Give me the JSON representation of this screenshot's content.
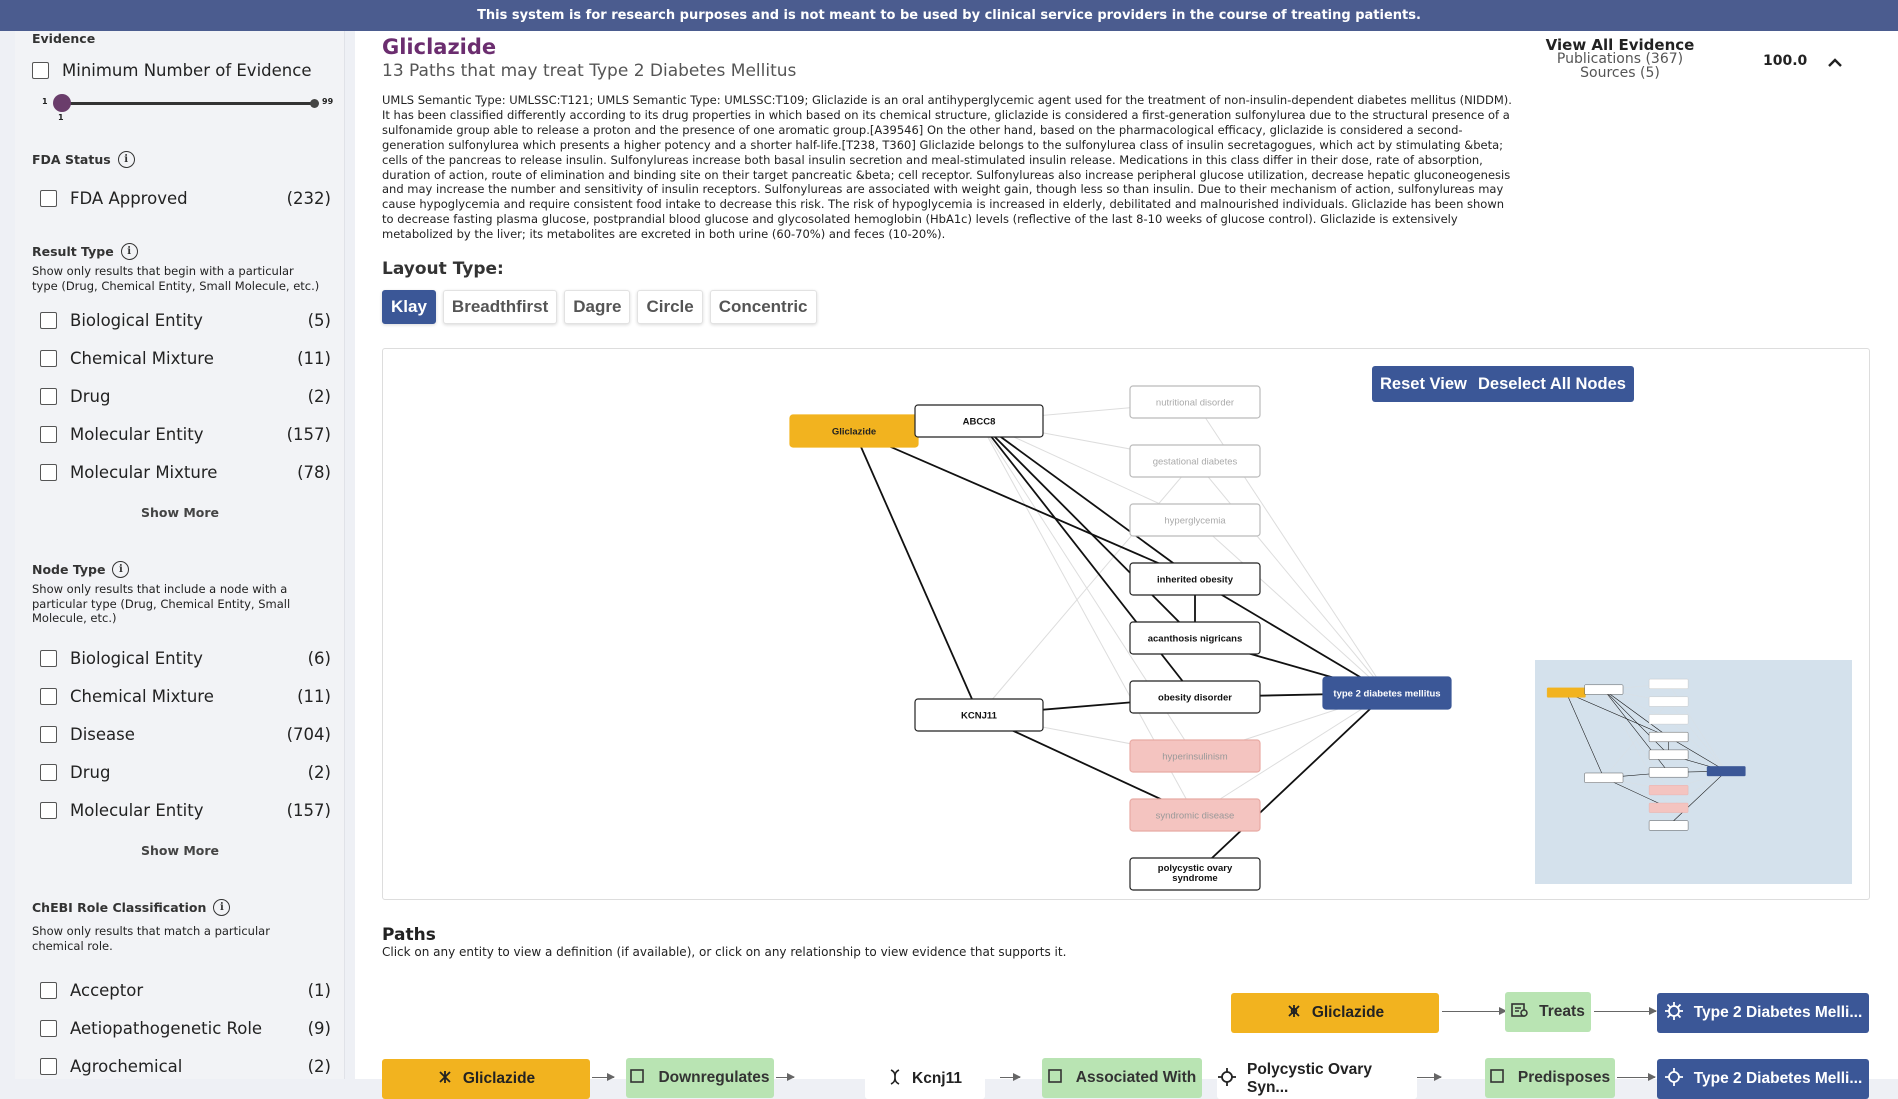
{
  "banner": "This system is for research purposes and is not meant to be used by clinical service providers in the course of treating patients.",
  "sidebar": {
    "evidence": {
      "title": "Evidence",
      "min_label": "Minimum Number of Evidence",
      "slider_min": "1",
      "slider_max": "99",
      "slider_value": "1"
    },
    "fda": {
      "title": "FDA Status",
      "items": [
        {
          "label": "FDA Approved",
          "count": "(232)"
        }
      ]
    },
    "result_type": {
      "title": "Result Type",
      "desc": "Show only results that begin with a particular type (Drug, Chemical Entity, Small Molecule, etc.)",
      "items": [
        {
          "label": "Biological Entity",
          "count": "(5)"
        },
        {
          "label": "Chemical Mixture",
          "count": "(11)"
        },
        {
          "label": "Drug",
          "count": "(2)"
        },
        {
          "label": "Molecular Entity",
          "count": "(157)"
        },
        {
          "label": "Molecular Mixture",
          "count": "(78)"
        }
      ],
      "show_more": "Show More"
    },
    "node_type": {
      "title": "Node Type",
      "desc": "Show only results that include a node with a particular type (Drug, Chemical Entity, Small Molecule, etc.)",
      "items": [
        {
          "label": "Biological Entity",
          "count": "(6)"
        },
        {
          "label": "Chemical Mixture",
          "count": "(11)"
        },
        {
          "label": "Disease",
          "count": "(704)"
        },
        {
          "label": "Drug",
          "count": "(2)"
        },
        {
          "label": "Molecular Entity",
          "count": "(157)"
        }
      ],
      "show_more": "Show More"
    },
    "chebi": {
      "title": "ChEBI Role Classification",
      "desc": "Show only results that match a particular chemical role.",
      "items": [
        {
          "label": "Acceptor",
          "count": "(1)"
        },
        {
          "label": "Aetiopathogenetic Role",
          "count": "(9)"
        },
        {
          "label": "Agrochemical",
          "count": "(2)"
        }
      ]
    }
  },
  "result": {
    "name": "Gliclazide",
    "subtitle": "13 Paths that may treat Type 2 Diabetes Mellitus",
    "description": "UMLS Semantic Type: UMLSSC:T121; UMLS Semantic Type: UMLSSC:T109; Gliclazide is an oral antihyperglycemic agent used for the treatment of non-insulin-dependent diabetes mellitus (NIDDM). It has been classified differently according to its drug properties in which based on its chemical structure, gliclazide is considered a first-generation sulfonylurea due to the structural presence of a sulfonamide group able to release a proton and the presence of one aromatic group.[A39546] On the other hand, based on the pharmacological efficacy, gliclazide is considered a second-generation sulfonylurea which presents a higher potency and a shorter half-life.[T238, T360] Gliclazide belongs to the sulfonylurea class of insulin secretagogues, which act by stimulating &beta; cells of the pancreas to release insulin. Sulfonylureas increase both basal insulin secretion and meal-stimulated insulin release. Medications in this class differ in their dose, rate of absorption, duration of action, route of elimination and binding site on their target pancreatic &beta; cell receptor. Sulfonylureas also increase peripheral glucose utilization, decrease hepatic gluconeogenesis and may increase the number and sensitivity of insulin receptors. Sulfonylureas are associated with weight gain, though less so than insulin. Due to their mechanism of action, sulfonylureas may cause hypoglycemia and require consistent food intake to decrease this risk. The risk of hypoglycemia is increased in elderly, debilitated and malnourished individuals. Gliclazide has been shown to decrease fasting plasma glucose, postprandial blood glucose and glycosolated hemoglobin (HbA1c) levels (reflective of the last 8-10 weeks of glucose control). Gliclazide is extensively metabolized by the liver; its metabolites are excreted in both urine (60-70%) and feces (10-20%).",
    "view_evidence": "View All Evidence",
    "publications": "Publications (367)",
    "sources": "Sources (5)",
    "score": "100.0"
  },
  "layout": {
    "label": "Layout Type:",
    "options": [
      "Klay",
      "Breadthfirst",
      "Dagre",
      "Circle",
      "Concentric"
    ],
    "active": "Klay"
  },
  "graph": {
    "reset_label": "Reset View",
    "deselect_label": "Deselect All Nodes",
    "nodes": [
      {
        "id": "gliclazide",
        "label": "Gliclazide",
        "style": "orange"
      },
      {
        "id": "abcc8",
        "label": "ABCC8",
        "style": "normal"
      },
      {
        "id": "kcnj11",
        "label": "KCNJ11",
        "style": "normal"
      },
      {
        "id": "nutritional",
        "label": "nutritional disorder",
        "style": "faded"
      },
      {
        "id": "gestational",
        "label": "gestational diabetes",
        "style": "faded"
      },
      {
        "id": "hyperglycemia",
        "label": "hyperglycemia",
        "style": "faded"
      },
      {
        "id": "obesity",
        "label": "inherited obesity",
        "style": "normal"
      },
      {
        "id": "acanthosis",
        "label": "acanthosis nigricans",
        "style": "normal"
      },
      {
        "id": "obesitydis",
        "label": "obesity disorder",
        "style": "normal"
      },
      {
        "id": "hyperins",
        "label": "hyperinsulinism",
        "style": "pink"
      },
      {
        "id": "syndromic",
        "label": "syndromic disease",
        "style": "pink"
      },
      {
        "id": "pcos",
        "label": "polycystic ovary syndrome",
        "style": "normal"
      },
      {
        "id": "t2dm",
        "label": "type 2 diabetes mellitus",
        "style": "blue"
      }
    ]
  },
  "paths": {
    "title": "Paths",
    "desc": "Click on any entity to view a definition (if available), or click on any relationship to view evidence that supports it.",
    "row1": {
      "start": "Gliclazide",
      "rel": "Treats",
      "end": "Type 2 Diabetes Melli..."
    },
    "row2": {
      "start": "Gliclazide",
      "rel1": "Downregulates",
      "mid": "Kcnj11",
      "rel2": "Associated With",
      "mid2": "Polycystic Ovary Syn...",
      "rel3": "Predisposes",
      "end": "Type 2 Diabetes Melli..."
    }
  }
}
